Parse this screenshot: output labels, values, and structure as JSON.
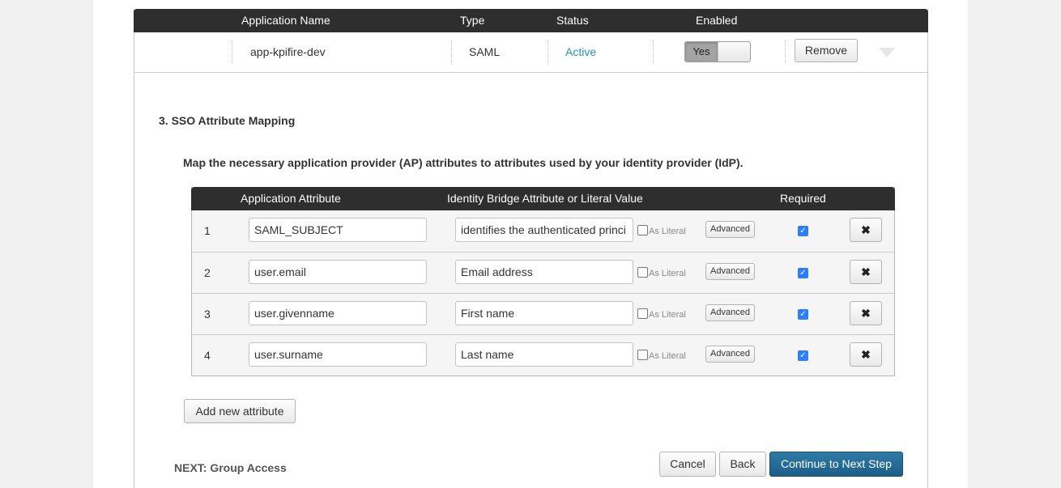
{
  "app_table": {
    "headers": {
      "name": "Application Name",
      "type": "Type",
      "status": "Status",
      "enabled": "Enabled"
    },
    "row": {
      "name": "app-kpifire-dev",
      "type": "SAML",
      "status": "Active",
      "enabled_label": "Yes",
      "remove_label": "Remove"
    }
  },
  "section": {
    "title": "3. SSO Attribute Mapping",
    "subtitle": "Map the necessary application provider (AP) attributes to attributes used by your identity provider (IdP)."
  },
  "mapping": {
    "headers": {
      "app_attr": "Application Attribute",
      "idb_attr": "Identity Bridge Attribute or Literal Value",
      "required": "Required"
    },
    "literal_label": "As Literal",
    "advanced_label": "Advanced",
    "remove_glyph": "✖",
    "check_glyph": "✓",
    "rows": [
      {
        "num": "1",
        "app_attr": "SAML_SUBJECT",
        "idb_value": "identifies the authenticated princi",
        "as_literal": false,
        "required": true
      },
      {
        "num": "2",
        "app_attr": "user.email",
        "idb_value": "Email address",
        "as_literal": false,
        "required": true
      },
      {
        "num": "3",
        "app_attr": "user.givenname",
        "idb_value": "First name",
        "as_literal": false,
        "required": true
      },
      {
        "num": "4",
        "app_attr": "user.surname",
        "idb_value": "Last name",
        "as_literal": false,
        "required": true
      }
    ]
  },
  "add_attribute_label": "Add new attribute",
  "footer": {
    "next_label": "NEXT: Group Access",
    "cancel_label": "Cancel",
    "back_label": "Back",
    "continue_label": "Continue to Next Step"
  },
  "colors": {
    "header_bg": "#2e2e2e",
    "status_active": "#2a8fc5",
    "primary_button": "#1b5f86",
    "checkbox_checked": "#2d7ff9"
  }
}
